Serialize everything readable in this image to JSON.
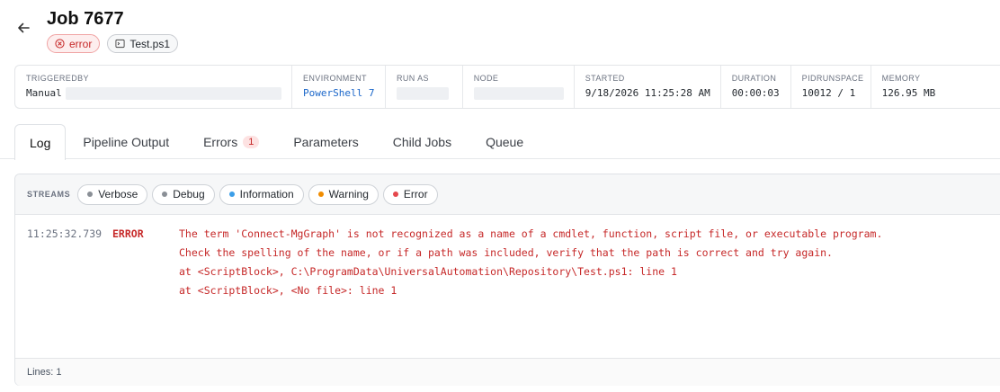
{
  "header": {
    "title": "Job 7677",
    "status_badge": "error",
    "script_badge": "Test.ps1"
  },
  "info": [
    {
      "label": "TRIGGEREDBY",
      "value": "Manual"
    },
    {
      "label": "ENVIRONMENT",
      "value": "PowerShell 7"
    },
    {
      "label": "RUN AS",
      "value": ""
    },
    {
      "label": "NODE",
      "value": ""
    },
    {
      "label": "STARTED",
      "value": "9/18/2026 11:25:28 AM"
    },
    {
      "label": "DURATION",
      "value": "00:00:03"
    },
    {
      "label": "PIDRUNSPACE",
      "value": "10012 / 1"
    },
    {
      "label": "MEMORY",
      "value": "126.95 MB"
    }
  ],
  "tabs": [
    {
      "label": "Log"
    },
    {
      "label": "Pipeline Output"
    },
    {
      "label": "Errors",
      "count": "1"
    },
    {
      "label": "Parameters"
    },
    {
      "label": "Child Jobs"
    },
    {
      "label": "Queue"
    }
  ],
  "streams": {
    "label": "STREAMS",
    "items": [
      {
        "label": "Verbose",
        "color": "#8a8f96"
      },
      {
        "label": "Debug",
        "color": "#8a8f96"
      },
      {
        "label": "Information",
        "color": "#3b9ee8"
      },
      {
        "label": "Warning",
        "color": "#f08c00"
      },
      {
        "label": "Error",
        "color": "#e5484d"
      }
    ]
  },
  "log": {
    "time": "11:25:32.739",
    "level": "ERROR",
    "lines": [
      "The term 'Connect-MgGraph' is not recognized as a name of a cmdlet, function, script file, or executable program.",
      "Check the spelling of the name, or if a path was included, verify that the path is correct and try again.",
      "at <ScriptBlock>, C:\\ProgramData\\UniversalAutomation\\Repository\\Test.ps1: line 1",
      "at <ScriptBlock>, <No file>: line 1"
    ],
    "footer": "Lines: 1"
  }
}
